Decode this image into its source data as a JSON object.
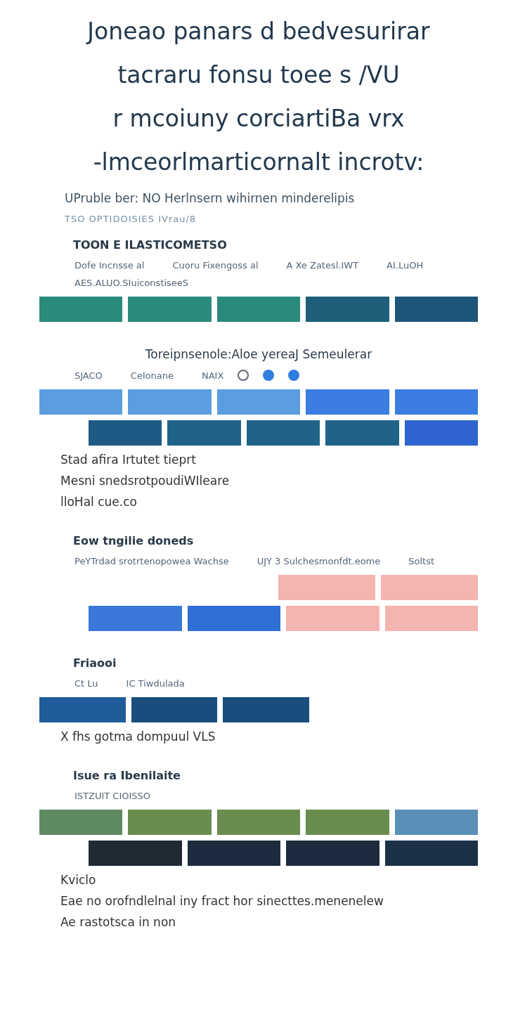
{
  "title_lines": [
    "Joneao panars d bedvesurirar",
    "tacraru fonsu toee s /VU",
    "r mcoiuny corciartiBa vrx",
    "-lmceorlmarticornalt incrotv:"
  ],
  "subtitle": "UPruble ber: NO Herlnsern wihirnen minderelipis",
  "caption": "TSO OPTIDOISIES IVrau/8",
  "sections": [
    {
      "heading": "TOON E ILASTICOMETSO",
      "labels": [
        "Dofe Incnsse al",
        "Cuoru Fixengoss al",
        "A Xe Zatesl.IWT",
        "AI.LuOH",
        "AES.ALUO.SIuiconstiseeS"
      ],
      "rows": [
        [
          {
            "color": "#2a8a7c"
          },
          {
            "color": "#2a8a7c"
          },
          {
            "color": "#2a8a7c"
          },
          {
            "color": "#1f5f7a"
          },
          {
            "color": "#1d5578"
          }
        ]
      ]
    },
    {
      "heading": "Toreipnsenole:Aloe yereaJ Semeulerar",
      "labels": [
        "SJACO",
        "Celonane",
        "NAIX"
      ],
      "options": [
        {
          "selected": false
        },
        {
          "selected": true
        },
        {
          "selected": true
        }
      ],
      "rows": [
        [
          {
            "color": "#5a9ee0"
          },
          {
            "color": "#5a9ee0"
          },
          {
            "color": "#5a9ee0"
          },
          {
            "color": "#3b7de0"
          },
          {
            "color": "#3b7de0"
          }
        ],
        [
          {
            "color": "#1d5a84"
          },
          {
            "color": "#1f6488"
          },
          {
            "color": "#1f6488"
          },
          {
            "color": "#1f6488"
          },
          {
            "color": "#2f63d0"
          }
        ]
      ],
      "notes": [
        "Stad afira Irtutet tieprt",
        "Mesni snedsrotpoudiWIleare",
        "lloHal cue.co"
      ]
    },
    {
      "heading": "Eow tngilie doneds",
      "labels": [
        "PeYTrdad srotrtenopowea Wachse",
        "UJY 3 Sulchesmonfdt.eome",
        "Soltst"
      ],
      "rows": [
        [
          {
            "color": "#f4b4b0"
          },
          {
            "color": "#f4b4b0"
          }
        ],
        [
          {
            "color": "#3a78dc"
          },
          {
            "color": "#2f6fd6"
          },
          {
            "color": "#f4b4b0"
          },
          {
            "color": "#f4b4b0"
          }
        ]
      ]
    },
    {
      "heading": "Friaooi",
      "labels": [
        "Ct Lu",
        "IC Tiwdulada"
      ],
      "rows": [
        [
          {
            "color": "#1f5c9a"
          },
          {
            "color": "#1a4d7e"
          },
          {
            "color": "#1a4d7e"
          }
        ]
      ],
      "notes": [
        "X fhs gotma dompuul VLS"
      ]
    },
    {
      "heading": "Isue ra Ibenilaite",
      "labels": [
        "ISTZUIT CIOISSO"
      ],
      "rows": [
        [
          {
            "color": "#5e8a62"
          },
          {
            "color": "#6a8c4e"
          },
          {
            "color": "#6a8c4e"
          },
          {
            "color": "#6a8c4e"
          },
          {
            "color": "#5a90b8"
          }
        ],
        [
          {
            "color": "#1e2a34"
          },
          {
            "color": "#1c2b3d"
          },
          {
            "color": "#1c2b3d"
          },
          {
            "color": "#1c3048"
          }
        ]
      ],
      "notes": [
        "Kviclo",
        "Eae no orofndlelnal iny fract hor sinecttes.menenelew",
        "Ae rastotsca in non"
      ]
    }
  ]
}
